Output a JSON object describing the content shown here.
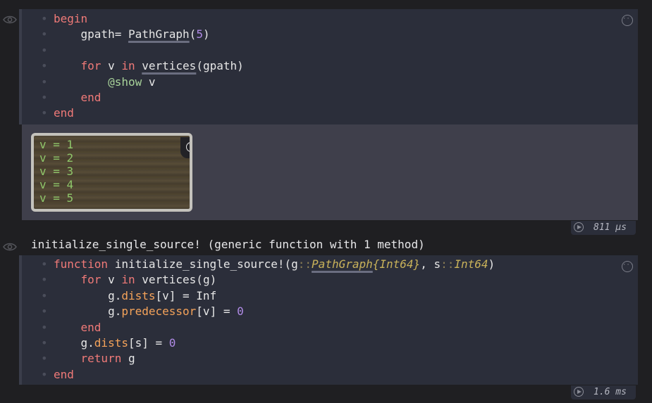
{
  "cell1": {
    "code_lines": [
      {
        "tokens": [
          {
            "t": "begin",
            "c": "kw"
          }
        ]
      },
      {
        "tokens": [
          {
            "t": "    gpath= ",
            "c": "fn"
          },
          {
            "t": "PathGraph",
            "c": "fn ul"
          },
          {
            "t": "(",
            "c": "fn"
          },
          {
            "t": "5",
            "c": "num"
          },
          {
            "t": ")",
            "c": "fn"
          }
        ]
      },
      {
        "tokens": []
      },
      {
        "tokens": [
          {
            "t": "    ",
            "c": "fn"
          },
          {
            "t": "for",
            "c": "kw"
          },
          {
            "t": " v ",
            "c": "fn"
          },
          {
            "t": "in",
            "c": "kw"
          },
          {
            "t": " ",
            "c": "fn"
          },
          {
            "t": "vertices",
            "c": "fn ul"
          },
          {
            "t": "(gpath)",
            "c": "fn"
          }
        ]
      },
      {
        "tokens": [
          {
            "t": "        ",
            "c": "fn"
          },
          {
            "t": "@show",
            "c": "macro"
          },
          {
            "t": " v",
            "c": "fn"
          }
        ]
      },
      {
        "tokens": [
          {
            "t": "    ",
            "c": "fn"
          },
          {
            "t": "end",
            "c": "kw"
          }
        ]
      },
      {
        "tokens": [
          {
            "t": "end",
            "c": "kw"
          }
        ]
      }
    ],
    "log_lines": [
      "v = 1",
      "v = 2",
      "v = 3",
      "v = 4",
      "v = 5"
    ],
    "runtime": "811 μs"
  },
  "cell2": {
    "output_text": "initialize_single_source! (generic function with 1 method)",
    "code_lines": [
      {
        "tokens": [
          {
            "t": "function",
            "c": "kw"
          },
          {
            "t": " initialize_single_source!",
            "c": "fn"
          },
          {
            "t": "(g",
            "c": "fn"
          },
          {
            "t": "::",
            "c": "typeop"
          },
          {
            "t": "PathGraph",
            "c": "type ul"
          },
          {
            "t": "{Int64}",
            "c": "type"
          },
          {
            "t": ", s",
            "c": "fn"
          },
          {
            "t": "::",
            "c": "typeop"
          },
          {
            "t": "Int64",
            "c": "type"
          },
          {
            "t": ")",
            "c": "fn"
          }
        ]
      },
      {
        "tokens": [
          {
            "t": "    ",
            "c": "fn"
          },
          {
            "t": "for",
            "c": "kw"
          },
          {
            "t": " v ",
            "c": "fn"
          },
          {
            "t": "in",
            "c": "kw"
          },
          {
            "t": " vertices(g)",
            "c": "fn"
          }
        ]
      },
      {
        "tokens": [
          {
            "t": "        g.",
            "c": "fn"
          },
          {
            "t": "dists",
            "c": "field"
          },
          {
            "t": "[v] = Inf",
            "c": "fn"
          }
        ]
      },
      {
        "tokens": [
          {
            "t": "        g.",
            "c": "fn"
          },
          {
            "t": "predecessor",
            "c": "field"
          },
          {
            "t": "[v] = ",
            "c": "fn"
          },
          {
            "t": "0",
            "c": "num"
          }
        ]
      },
      {
        "tokens": [
          {
            "t": "    ",
            "c": "fn"
          },
          {
            "t": "end",
            "c": "kw"
          }
        ]
      },
      {
        "tokens": [
          {
            "t": "    g.",
            "c": "fn"
          },
          {
            "t": "dists",
            "c": "field"
          },
          {
            "t": "[s] = ",
            "c": "fn"
          },
          {
            "t": "0",
            "c": "num"
          }
        ]
      },
      {
        "tokens": [
          {
            "t": "    ",
            "c": "fn"
          },
          {
            "t": "return",
            "c": "kw"
          },
          {
            "t": " g",
            "c": "fn"
          }
        ]
      },
      {
        "tokens": [
          {
            "t": "end",
            "c": "kw"
          }
        ]
      }
    ],
    "runtime": "1.6 ms"
  },
  "icons": {
    "eye": "eye-icon",
    "menu": "more-options-icon",
    "help": "help-icon",
    "run": "run-cell-icon"
  },
  "colors": {
    "keyword": "#f07a78",
    "number": "#b08be6",
    "macro": "#a8d39a",
    "field": "#f5a35a",
    "type": "#c9b25a",
    "log_text": "#8fc66a"
  }
}
